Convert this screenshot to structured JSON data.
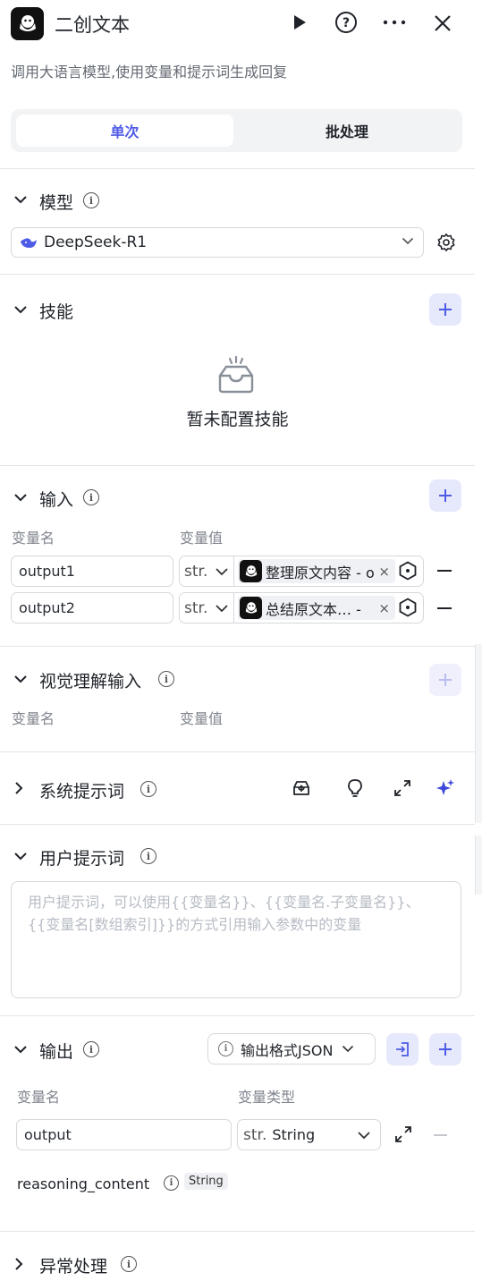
{
  "header": {
    "title": "二创文本",
    "description": "调用大语言模型,使用变量和提示词生成回复"
  },
  "tabs": [
    {
      "label": "单次",
      "active": true
    },
    {
      "label": "批处理",
      "active": false
    }
  ],
  "model": {
    "section_title": "模型",
    "selected": "DeepSeek-R1"
  },
  "skills": {
    "section_title": "技能",
    "empty_text": "暂未配置技能"
  },
  "inputs": {
    "section_title": "输入",
    "col_name": "变量名",
    "col_value": "变量值",
    "rows": [
      {
        "name": "output1",
        "type": "str.",
        "ref": "整理原文内容 - o",
        "ref_close": "×"
      },
      {
        "name": "output2",
        "type": "str.",
        "ref": "总结原文本… -",
        "ref_close": "×"
      }
    ]
  },
  "vision": {
    "section_title": "视觉理解输入",
    "col_name": "变量名",
    "col_value": "变量值"
  },
  "system_prompt": {
    "section_title": "系统提示词"
  },
  "user_prompt": {
    "section_title": "用户提示词",
    "placeholder": "用户提示词，可以使用{{变量名}}、{{变量名.子变量名}}、{{变量名[数组索引]}}的方式引用输入参数中的变量"
  },
  "output": {
    "section_title": "输出",
    "format_label": "输出格式JSON",
    "col_name": "变量名",
    "col_type": "变量类型",
    "row_name": "output",
    "row_type_prefix": "str.",
    "row_type": "String",
    "reasoning_name": "reasoning_content",
    "reasoning_type": "String"
  },
  "exception": {
    "section_title": "异常处理"
  },
  "colors": {
    "accent": "#4e5be6",
    "accent_bg": "#e6e8fb",
    "border": "#d5d8dc",
    "muted": "#80858e"
  }
}
